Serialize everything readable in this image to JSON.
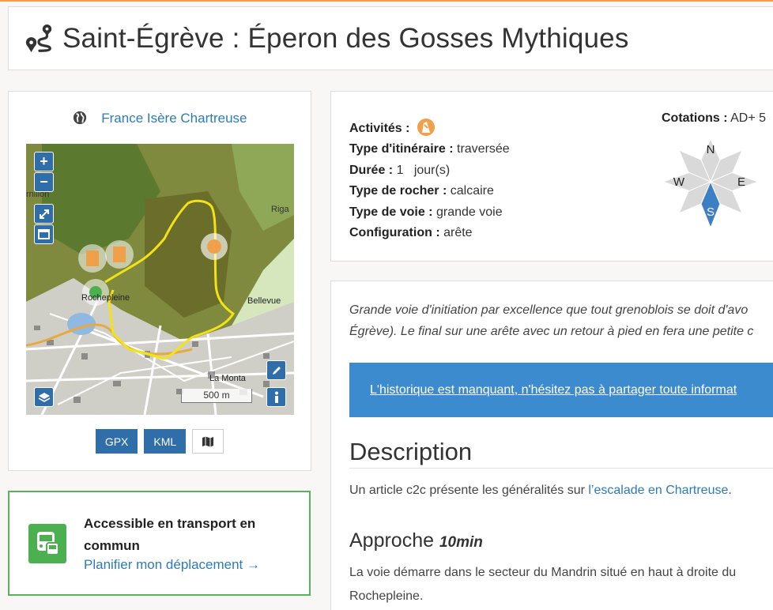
{
  "page": {
    "title": "Saint-Égrève : Éperon des Gosses Mythiques",
    "accent_color": "#f0a04b"
  },
  "location": {
    "areas": "France Isère Chartreuse"
  },
  "map": {
    "labels": {
      "vernillon": "rnillon",
      "rigal": "Riga",
      "rochepleine": "Rochepleine",
      "bellevue": "Bellevue",
      "la_monta": "La Monta"
    },
    "scale": "500 m",
    "zoom_in": "+",
    "zoom_out": "−"
  },
  "downloads": {
    "gpx": "GPX",
    "kml": "KML"
  },
  "transport": {
    "title": "Accessible en transport en commun",
    "link": "Planifier mon déplacement →",
    "color": "#4caf50"
  },
  "info": {
    "activities_label": "Activités :",
    "route_type_label": "Type d'itinéraire :",
    "route_type": "traversée",
    "duration_label": "Durée :",
    "duration": "1",
    "duration_unit": "jour(s)",
    "rock_type_label": "Type de rocher :",
    "rock_type": "calcaire",
    "climbing_type_label": "Type de voie :",
    "climbing_type": "grande voie",
    "configuration_label": "Configuration :",
    "configuration": "arête",
    "ratings_label": "Cotations :",
    "ratings": "AD+ 5",
    "orientation": {
      "north": "N",
      "south": "S",
      "east": "E",
      "west": "W",
      "highlight_color": "#3d7fc4"
    }
  },
  "content": {
    "summary_line1": "Grande voie d'initiation par excellence que tout grenoblois se doit d'avo",
    "summary_line2": "Égrève). Le final sur une arête avec un retour à pied en fera une petite c",
    "history_banner": "L'historique est manquant, n'hésitez pas à partager toute informat",
    "description_title": "Description",
    "description_text": "Un article c2c présente les généralités sur ",
    "description_link": "l’escalade en Chartreuse",
    "description_end": ".",
    "approach_title": "Approche",
    "approach_time": "10min",
    "approach_line1": "La voie démarre dans le secteur du Mandrin situé en haut à droite du",
    "approach_line2": "Rochepleine."
  }
}
